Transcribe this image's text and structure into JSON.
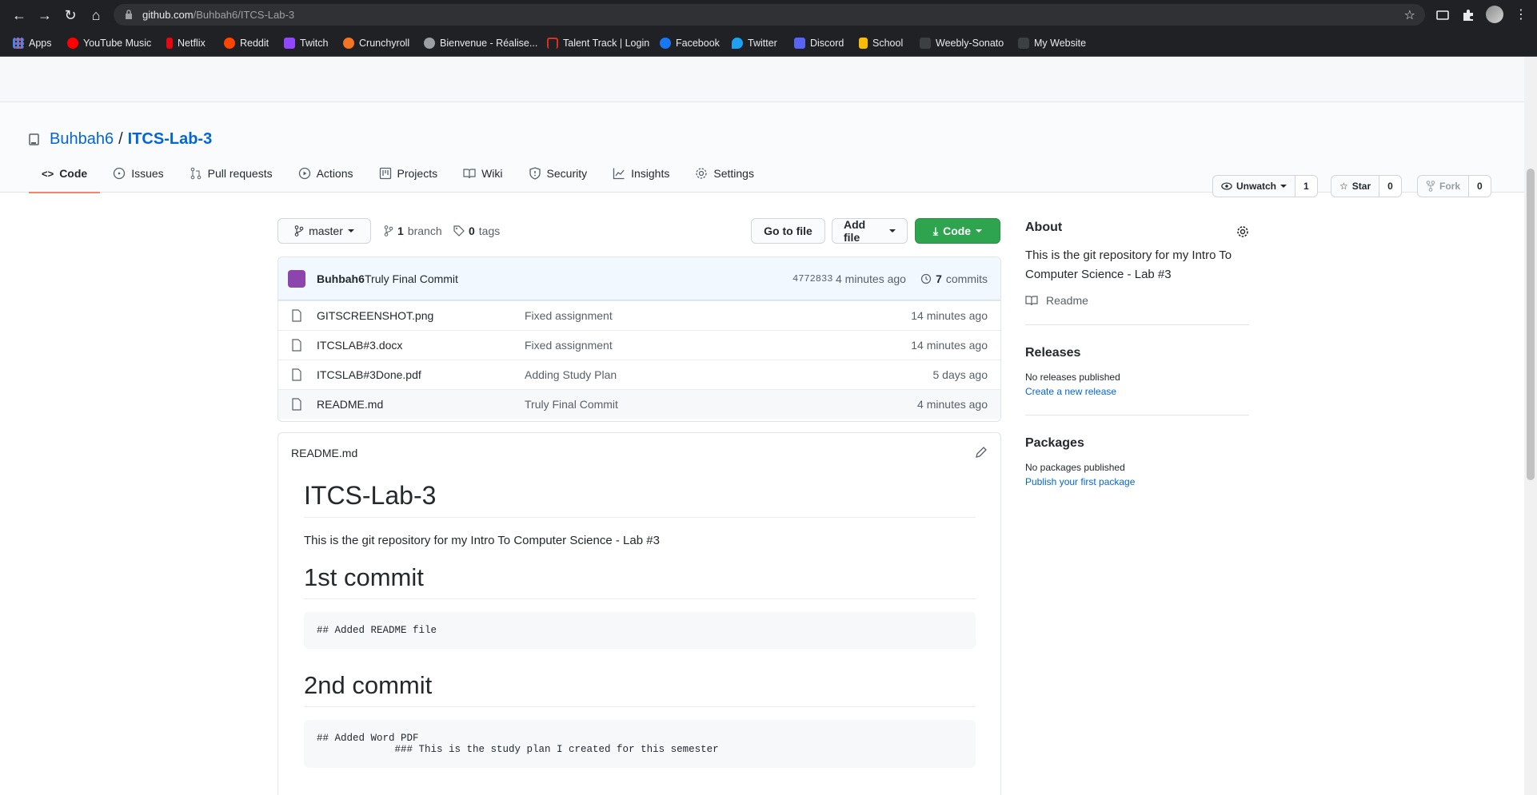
{
  "browser": {
    "url_host": "github.com",
    "url_path": "/Buhbah6/ITCS-Lab-3"
  },
  "bookmarks": [
    {
      "label": "Apps",
      "color": "#4285f4"
    },
    {
      "label": "YouTube Music",
      "color": "#ff0000"
    },
    {
      "label": "Netflix",
      "color": "#e50914"
    },
    {
      "label": "Reddit",
      "color": "#ff4500"
    },
    {
      "label": "Twitch",
      "color": "#9146ff"
    },
    {
      "label": "Crunchyroll",
      "color": "#f47521"
    },
    {
      "label": "Bienvenue - Réalise...",
      "color": "#9aa0a6"
    },
    {
      "label": "Talent Track | Login",
      "color": "#d93025"
    },
    {
      "label": "Facebook",
      "color": "#1877f2"
    },
    {
      "label": "Twitter",
      "color": "#1da1f2"
    },
    {
      "label": "Discord",
      "color": "#5865f2"
    },
    {
      "label": "School",
      "color": "#fbbc04"
    },
    {
      "label": "Weebly-Sonato",
      "color": "#3c4043"
    },
    {
      "label": "My Website",
      "color": "#3c4043"
    }
  ],
  "repo": {
    "owner": "Buhbah6",
    "separator": "/",
    "name": "ITCS-Lab-3",
    "unwatch_label": "Unwatch",
    "unwatch_count": "1",
    "star_label": "Star",
    "star_count": "0",
    "fork_label": "Fork",
    "fork_count": "0"
  },
  "tabs": [
    {
      "label": "Code",
      "icon": "code-icon"
    },
    {
      "label": "Issues",
      "icon": "issue-icon"
    },
    {
      "label": "Pull requests",
      "icon": "pull-request-icon"
    },
    {
      "label": "Actions",
      "icon": "play-icon"
    },
    {
      "label": "Projects",
      "icon": "project-icon"
    },
    {
      "label": "Wiki",
      "icon": "book-icon"
    },
    {
      "label": "Security",
      "icon": "shield-icon"
    },
    {
      "label": "Insights",
      "icon": "graph-icon"
    },
    {
      "label": "Settings",
      "icon": "gear-icon"
    }
  ],
  "toolbar": {
    "branch": "master",
    "branch_count": "1",
    "branch_word": "branch",
    "tag_count": "0",
    "tag_word": "tags",
    "go_to_file": "Go to file",
    "add_file": "Add file",
    "code": "Code"
  },
  "latest_commit": {
    "author": "Buhbah6",
    "message": "Truly Final Commit",
    "sha": "4772833",
    "time": "4 minutes ago",
    "count": "7",
    "count_word": "commits"
  },
  "files": [
    {
      "name": "GITSCREENSHOT.png",
      "message": "Fixed assignment",
      "age": "14 minutes ago"
    },
    {
      "name": "ITCSLAB#3.docx",
      "message": "Fixed assignment",
      "age": "14 minutes ago"
    },
    {
      "name": "ITCSLAB#3Done.pdf",
      "message": "Adding Study Plan",
      "age": "5 days ago"
    },
    {
      "name": "README.md",
      "message": "Truly Final Commit",
      "age": "4 minutes ago"
    }
  ],
  "readme": {
    "filename": "README.md",
    "title": "ITCS-Lab-3",
    "intro": "This is the git repository for my Intro To Computer Science - Lab #3",
    "sections": [
      {
        "heading": "1st commit",
        "code": "## Added README file"
      },
      {
        "heading": "2nd commit",
        "code": "## Added Word PDF\n             ### This is the study plan I created for this semester"
      }
    ]
  },
  "about": {
    "heading": "About",
    "description": "This is the git repository for my Intro To Computer Science - Lab #3",
    "readme_label": "Readme",
    "releases_heading": "Releases",
    "releases_text": "No releases published",
    "releases_link": "Create a new release",
    "packages_heading": "Packages",
    "packages_text": "No packages published",
    "packages_link": "Publish your first package"
  },
  "colors": {
    "link": "#0366d6",
    "primary_button": "#2ea44f",
    "active_tab_underline": "#f9826c"
  }
}
